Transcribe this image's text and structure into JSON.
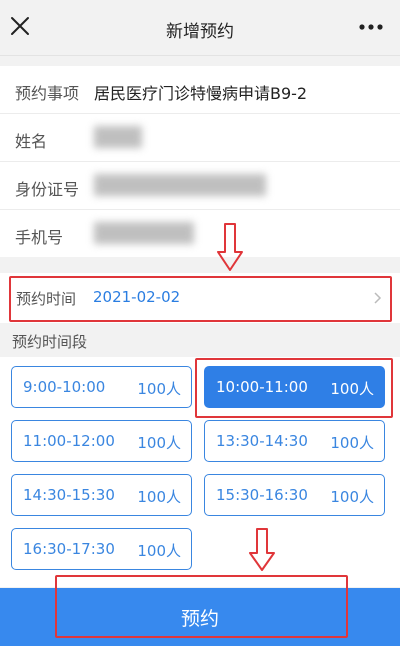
{
  "nav": {
    "title": "新增预约",
    "close_icon": "close-icon",
    "more_icon": "more-dots-icon"
  },
  "form": {
    "item_label": "预约事项",
    "item_value": "居民医疗门诊特慢病申请B9-2",
    "name_label": "姓名",
    "id_label": "身份证号",
    "phone_label": "手机号"
  },
  "date": {
    "label": "预约时间",
    "value": "2021-02-02",
    "chevron_icon": "chevron-right-icon"
  },
  "slots": {
    "title": "预约时间段",
    "items": [
      {
        "time": "9:00-10:00",
        "cap": "100人"
      },
      {
        "time": "10:00-11:00",
        "cap": "100人"
      },
      {
        "time": "11:00-12:00",
        "cap": "100人"
      },
      {
        "time": "13:30-14:30",
        "cap": "100人"
      },
      {
        "time": "14:30-15:30",
        "cap": "100人"
      },
      {
        "time": "15:30-16:30",
        "cap": "100人"
      },
      {
        "time": "16:30-17:30",
        "cap": "100人"
      }
    ],
    "selected": "10:00-11:00"
  },
  "submit": {
    "label": "预约"
  },
  "colors": {
    "accent": "#2f7fe6",
    "highlight": "#e0363a"
  }
}
